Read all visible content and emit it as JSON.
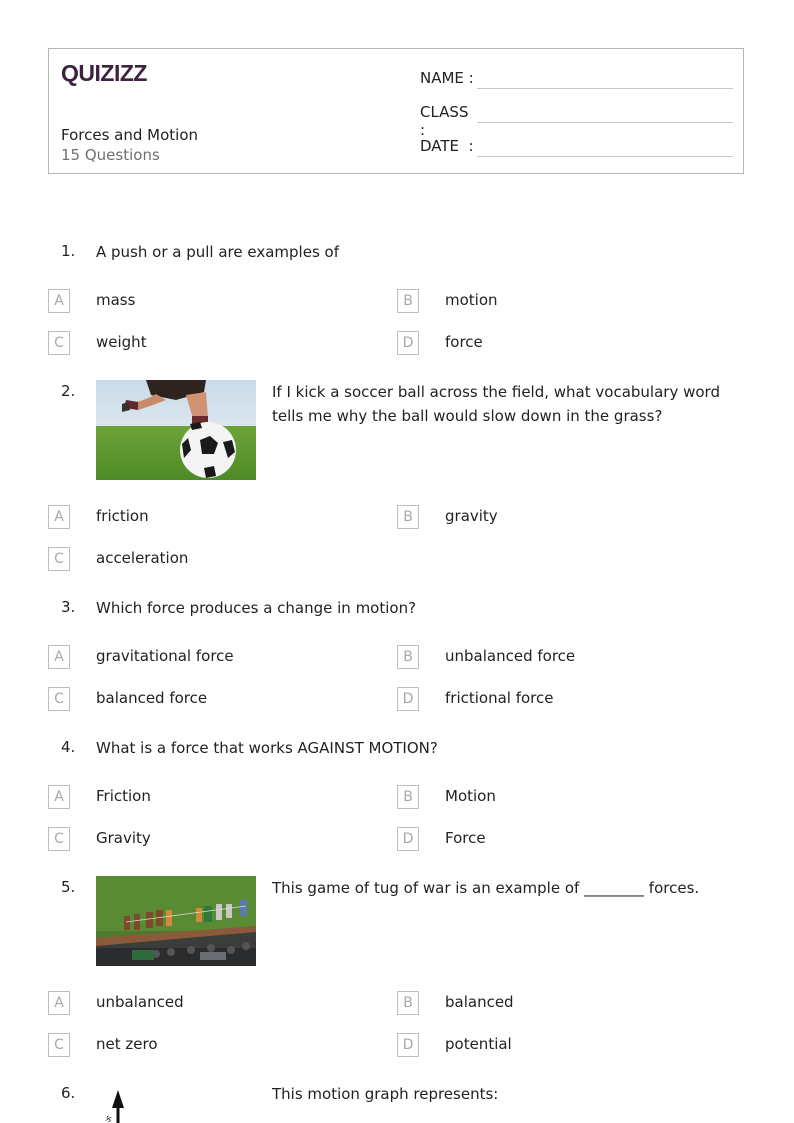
{
  "header": {
    "brand": "QUIZIZZ",
    "worksheet_title": "Forces and Motion",
    "question_count": "15 Questions",
    "fields": [
      {
        "label": "NAME :",
        "value": ""
      },
      {
        "label": "CLASS :",
        "value": ""
      },
      {
        "label": "DATE  :",
        "value": ""
      }
    ]
  },
  "questions": [
    {
      "number": "1.",
      "text": "A push or a pull are examples of",
      "options": [
        {
          "letter": "A",
          "text": "mass"
        },
        {
          "letter": "B",
          "text": "motion"
        },
        {
          "letter": "C",
          "text": "weight"
        },
        {
          "letter": "D",
          "text": "force"
        }
      ]
    },
    {
      "number": "2.",
      "image": "soccer-ball-kick-photo",
      "text": "If I kick a soccer ball across the field, what vocabulary word tells me why the ball would slow down in the grass?",
      "options": [
        {
          "letter": "A",
          "text": "friction"
        },
        {
          "letter": "B",
          "text": "gravity"
        },
        {
          "letter": "C",
          "text": "acceleration"
        }
      ]
    },
    {
      "number": "3.",
      "text": "Which force produces a change in motion?",
      "options": [
        {
          "letter": "A",
          "text": "gravitational force"
        },
        {
          "letter": "B",
          "text": "unbalanced force"
        },
        {
          "letter": "C",
          "text": "balanced force"
        },
        {
          "letter": "D",
          "text": "frictional force"
        }
      ]
    },
    {
      "number": "4.",
      "text": "What is a force that works AGAINST MOTION?",
      "options": [
        {
          "letter": "A",
          "text": "Friction"
        },
        {
          "letter": "B",
          "text": "Motion"
        },
        {
          "letter": "C",
          "text": "Gravity"
        },
        {
          "letter": "D",
          "text": "Force"
        }
      ]
    },
    {
      "number": "5.",
      "image": "tug-of-war-photo",
      "text": "This game of tug of war is an example of ________ forces.",
      "options": [
        {
          "letter": "A",
          "text": "unbalanced"
        },
        {
          "letter": "B",
          "text": "balanced"
        },
        {
          "letter": "C",
          "text": "net zero"
        },
        {
          "letter": "D",
          "text": "potential"
        }
      ]
    },
    {
      "number": "6.",
      "image": "motion-graph",
      "text": "This motion graph represents:",
      "graph_axis_label": "ક"
    }
  ]
}
